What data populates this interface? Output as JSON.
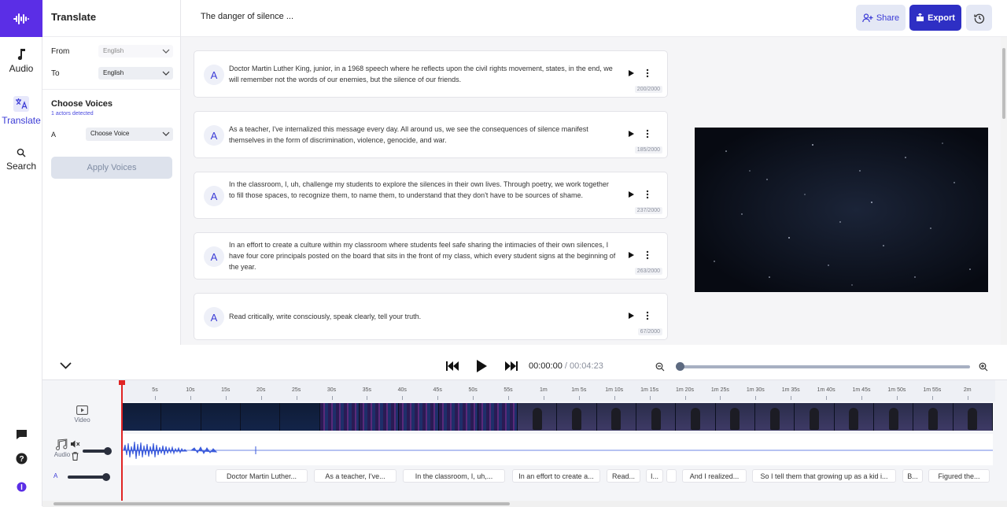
{
  "header": {
    "panel_title": "Translate",
    "doc_title": "The danger of silence ...",
    "share_label": "Share",
    "export_label": "Export"
  },
  "rail": {
    "items": [
      {
        "label": "Audio",
        "icon": "music-note-icon"
      },
      {
        "label": "Translate",
        "icon": "translate-icon"
      },
      {
        "label": "Search",
        "icon": "search-icon"
      }
    ]
  },
  "languages": {
    "from_label": "From",
    "from_value": "English",
    "to_label": "To",
    "to_value": "English"
  },
  "voices": {
    "title": "Choose Voices",
    "subtitle": "1 actors detected",
    "actor": "A",
    "select_value": "Choose Voice",
    "apply_label": "Apply Voices"
  },
  "segments": [
    {
      "speaker": "A",
      "text": "Doctor Martin Luther King, junior, in a 1968 speech where he reflects upon the civil rights movement, states, in the end, we will remember not the words of our enemies, but the silence of our friends.",
      "count": "200/2000"
    },
    {
      "speaker": "A",
      "text": "As a teacher, I've internalized this message every day. All around us, we see the consequences of silence manifest themselves in the form of discrimination, violence, genocide, and war.",
      "count": "185/2000"
    },
    {
      "speaker": "A",
      "text": "In the classroom, I, uh, challenge my students to explore the silences in their own lives. Through poetry, we work together to fill those spaces, to recognize them, to name them, to understand that they don't have to be sources of shame.",
      "count": "237/2000"
    },
    {
      "speaker": "A",
      "text": "In an effort to create a culture within my classroom where students feel safe sharing the intimacies of their own silences, I have four core principals posted on the board that sits in the front of my class, which every student signs at the beginning of the year.",
      "count": "263/2000"
    },
    {
      "speaker": "A",
      "text": "Read critically, write consciously, speak clearly, tell your truth.",
      "count": "67/2000"
    }
  ],
  "player": {
    "current_time": "00:00:00",
    "separator": " / ",
    "total_time": "00:04:23",
    "zoom_level": 0.02
  },
  "timeline": {
    "ticks": [
      "5s",
      "10s",
      "15s",
      "20s",
      "25s",
      "30s",
      "35s",
      "40s",
      "45s",
      "50s",
      "55s",
      "1m",
      "1m 5s",
      "1m 10s",
      "1m 15s",
      "1m 20s",
      "1m 25s",
      "1m 30s",
      "1m 35s",
      "1m 40s",
      "1m 45s",
      "1m 50s",
      "1m 55s",
      "2m"
    ],
    "video_label": "Video",
    "audio_label": "Audio",
    "caption_track": "A",
    "captions": [
      {
        "text": "Doctor Martin Luther..."
      },
      {
        "text": "As a teacher, I've..."
      },
      {
        "text": "In the classroom, I, uh,..."
      },
      {
        "text": "In an effort to create a..."
      },
      {
        "text": "Read..."
      },
      {
        "text": "I..."
      },
      {
        "text": ""
      },
      {
        "text": "And I realized..."
      },
      {
        "text": "So I tell them that growing up as a kid i..."
      },
      {
        "text": "B..."
      },
      {
        "text": "Figured the..."
      }
    ]
  },
  "colors": {
    "brand": "#5b2ee6",
    "accent": "#2e2fc4",
    "playhead": "#e02424",
    "waveform": "#3b5bdb"
  }
}
